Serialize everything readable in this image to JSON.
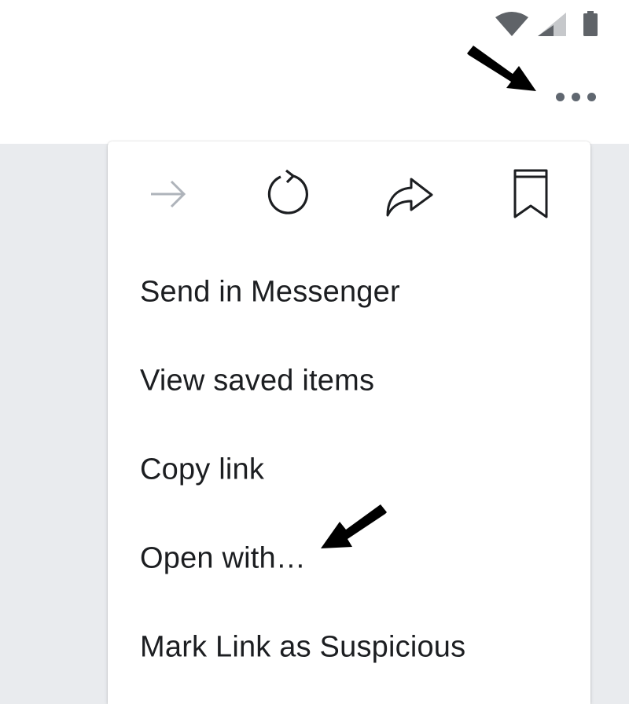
{
  "status_bar": {
    "icons": [
      "wifi-icon",
      "cellular-signal-icon",
      "battery-icon"
    ]
  },
  "toolbar": {
    "more_icon": "more-horizontal-icon"
  },
  "menu": {
    "icon_row": [
      {
        "name": "forward-arrow-icon",
        "enabled": false
      },
      {
        "name": "refresh-icon",
        "enabled": true
      },
      {
        "name": "share-icon",
        "enabled": true
      },
      {
        "name": "bookmark-icon",
        "enabled": true
      }
    ],
    "items": [
      {
        "label": "Send in Messenger"
      },
      {
        "label": "View saved items"
      },
      {
        "label": "Copy link"
      },
      {
        "label": "Open with…"
      },
      {
        "label": "Mark Link as Suspicious"
      }
    ]
  },
  "colors": {
    "background": "#e9ebee",
    "surface": "#ffffff",
    "text": "#1c1e21",
    "icon_disabled": "#bec3c9",
    "icon": "#1c1e21",
    "dots": "#606770",
    "status_icons": "#5f6368"
  },
  "annotations": [
    {
      "name": "annotation-arrow-to-more",
      "points_to": "more-button"
    },
    {
      "name": "annotation-arrow-to-open-with",
      "points_to": "menu-item-open-with"
    }
  ]
}
